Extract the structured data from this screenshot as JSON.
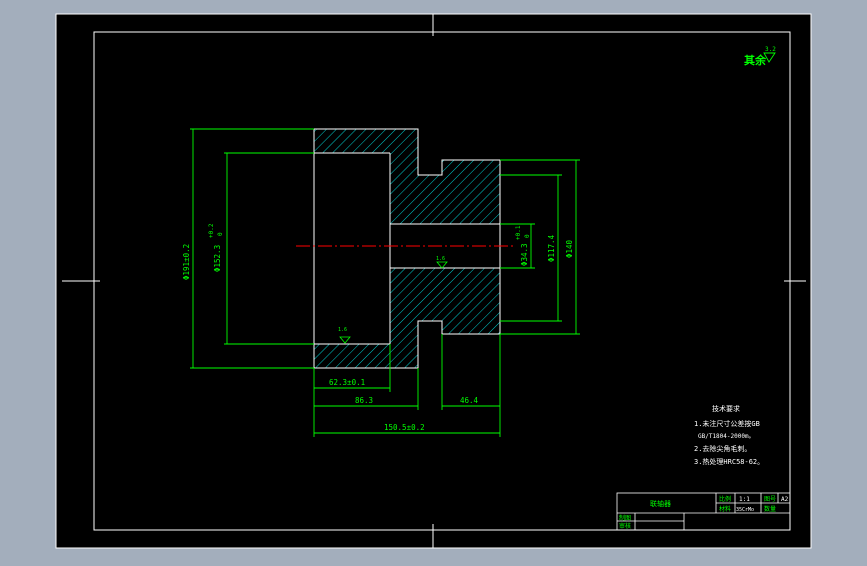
{
  "surface_finish": {
    "label": "其余",
    "value": "3.2"
  },
  "dimensions": {
    "outer_dia": "Φ191±0.2",
    "bore_dia": "Φ152.3",
    "bore_tol_upper": "+0.2",
    "bore_tol_lower": "0",
    "hub_dia": "Φ140",
    "step_dia": "Φ117.4",
    "shaft_dia": "Φ34.3",
    "shaft_tol_upper": "+0.1",
    "shaft_tol_lower": "0",
    "bore_depth": "62.3±0.1",
    "flange_len": "86.3",
    "hub_len": "46.4",
    "total_len": "150.5±0.2"
  },
  "roughness_marks": [
    "1.6",
    "1.6"
  ],
  "tech_requirements": {
    "title": "技术要求",
    "items": [
      "1.未注尺寸公差按GB",
      "GB/T1804-2000m。",
      "2.去除尖角毛刺。",
      "3.热处理HRC58-62。"
    ]
  },
  "title_block": {
    "part_name": "联轴器",
    "ratio_label": "比例",
    "ratio_value": "1:1",
    "sheet_label": "图号",
    "sheet_value": "A2",
    "material_label": "材料",
    "material_value": "35CrMo",
    "qty_label": "数量",
    "designer_label": "制图",
    "checker_label": "审核"
  },
  "colors": {
    "background": "#000000",
    "frame": "#ffffff",
    "dimension": "#00ff00",
    "hatch": "#00ffff",
    "centerline": "#ff0000"
  }
}
